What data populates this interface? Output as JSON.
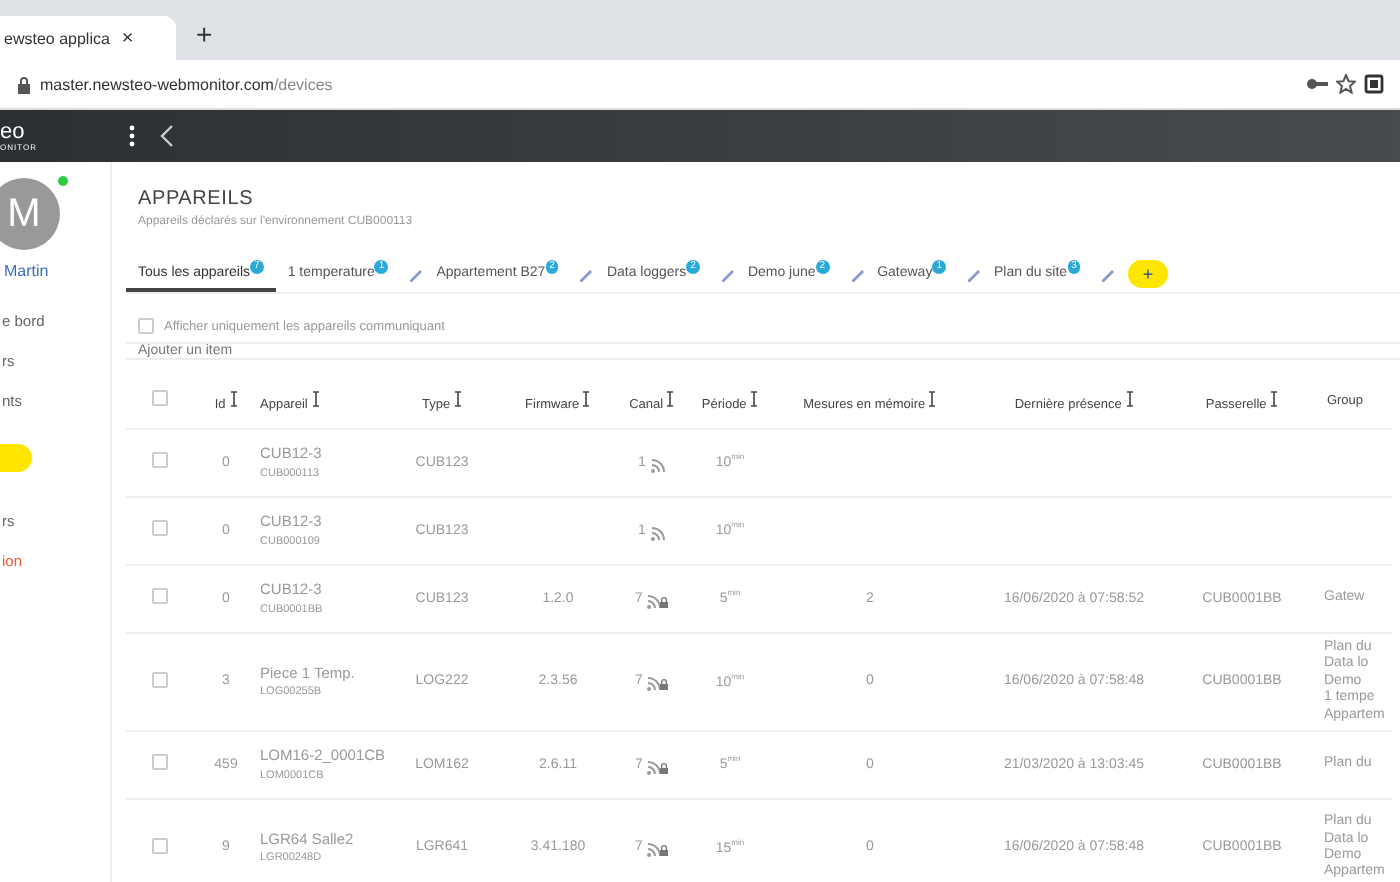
{
  "browser": {
    "tab_title": "ewsteo applica",
    "tab_close": "×",
    "new_tab": "+",
    "url_host": "master.newsteo-webmonitor.com",
    "url_path": "/devices"
  },
  "header": {
    "logo_top": "eo",
    "logo_bottom": "ONITOR"
  },
  "sidebar": {
    "avatar_letter": "M",
    "online": true,
    "user": "Martin",
    "items": [
      {
        "label": "e bord",
        "kind": "normal"
      },
      {
        "label": "rs",
        "kind": "normal"
      },
      {
        "label": "nts",
        "kind": "normal"
      },
      {
        "kind": "highlight"
      },
      {
        "label": "rs",
        "kind": "normal"
      },
      {
        "label": "ion",
        "kind": "danger"
      }
    ]
  },
  "page": {
    "title": "APPAREILS",
    "subtitle": "Appareils déclarés sur l'environnement CUB000113"
  },
  "tabs": [
    {
      "label": "Tous les appareils",
      "badge": "7",
      "selected": true,
      "editable": false
    },
    {
      "label": "1 temperature",
      "badge": "1",
      "selected": false,
      "editable": true
    },
    {
      "label": "Appartement B27",
      "badge": "2",
      "selected": false,
      "editable": true
    },
    {
      "label": "Data loggers",
      "badge": "2",
      "selected": false,
      "editable": true
    },
    {
      "label": "Demo june",
      "badge": "2",
      "selected": false,
      "editable": true
    },
    {
      "label": "Gateway",
      "badge": "1",
      "selected": false,
      "editable": true
    },
    {
      "label": "Plan du site",
      "badge": "3",
      "selected": false,
      "editable": true
    }
  ],
  "add_tab": {
    "label": "+",
    "highlighted": true
  },
  "filter": {
    "label": "Afficher uniquement les appareils communiquant",
    "checked": false
  },
  "add_item": {
    "placeholder": "Ajouter un item"
  },
  "table": {
    "select_all": false,
    "columns": [
      "Id",
      "Appareil",
      "Type",
      "Firmware",
      "Canal",
      "Période",
      "Mesures en mémoire",
      "Dernière présence",
      "Passerelle",
      "Group"
    ],
    "rows": [
      {
        "checked": false,
        "id": "0",
        "name": "CUB12-3",
        "serial": "CUB000113",
        "type": "CUB123",
        "firmware": "",
        "canal": "1",
        "locked": false,
        "period": "10$^{min}$",
        "mesures": "",
        "last_seen": "",
        "gateway": "",
        "groups": []
      },
      {
        "checked": false,
        "id": "0",
        "name": "CUB12-3",
        "serial": "CUB000109",
        "type": "CUB123",
        "firmware": "",
        "canal": "1",
        "locked": false,
        "period": "10$^{min}$",
        "mesures": "",
        "last_seen": "",
        "gateway": "",
        "groups": []
      },
      {
        "checked": false,
        "id": "0",
        "name": "CUB12-3",
        "serial": "CUB0001BB",
        "type": "CUB123",
        "firmware": "1.2.0",
        "canal": "7",
        "locked": true,
        "period": "5$^{min}$",
        "mesures": "2",
        "last_seen": "16/06/2020 à 07:58:52",
        "gateway": "CUB0001BB",
        "groups": [
          "Gatew"
        ]
      },
      {
        "checked": false,
        "id": "3",
        "name": "Piece 1 Temp.",
        "serial": "LOG00255B",
        "type": "LOG222",
        "firmware": "2.3.56",
        "canal": "7",
        "locked": true,
        "period": "10$^{min}$",
        "mesures": "0",
        "last_seen": "16/06/2020 à 07:58:48",
        "gateway": "CUB0001BB",
        "groups": [
          "Plan du",
          "Data lo",
          "Demo",
          "1 tempe",
          "Appartem"
        ]
      },
      {
        "checked": false,
        "id": "459",
        "name": "LOM16-2_0001CB",
        "serial": "LOM0001CB",
        "type": "LOM162",
        "firmware": "2.6.11",
        "canal": "7",
        "locked": true,
        "period": "5$^{min}$",
        "mesures": "0",
        "last_seen": "21/03/2020 à 13:03:45",
        "gateway": "CUB0001BB",
        "groups": [
          "Plan du"
        ]
      },
      {
        "checked": false,
        "id": "9",
        "name": "LGR64 Salle2",
        "serial": "LGR00248D",
        "type": "LGR641",
        "firmware": "3.41.180",
        "canal": "7",
        "locked": true,
        "period": "15$^{min}$",
        "mesures": "0",
        "last_seen": "16/06/2020 à 07:58:48",
        "gateway": "CUB0001BB",
        "groups": [
          "Plan du",
          "Data lo",
          "Demo",
          "Appartem"
        ]
      }
    ]
  }
}
